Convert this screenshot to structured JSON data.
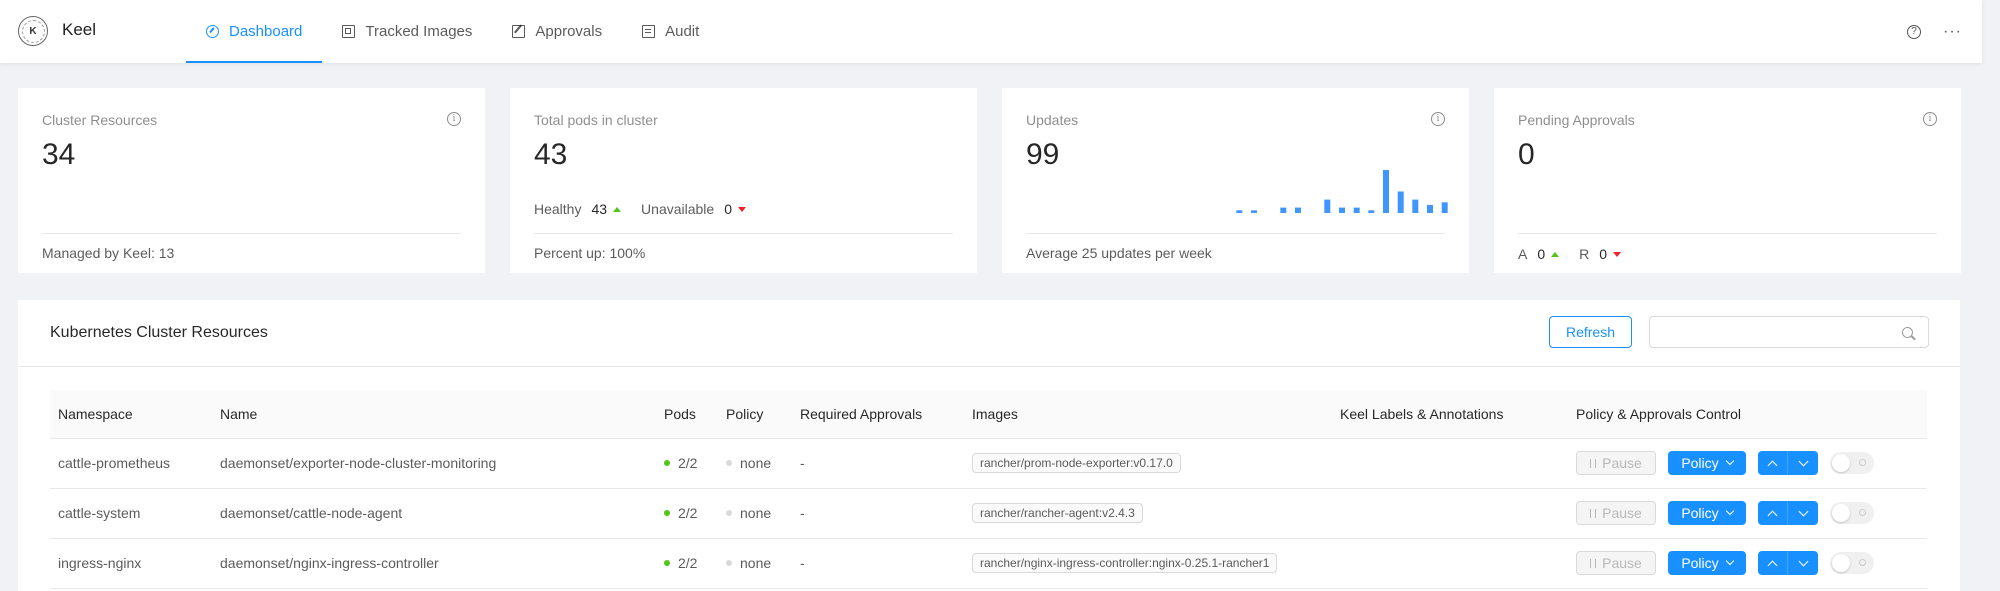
{
  "app": {
    "brand": "Keel",
    "logo_letter": "K",
    "accent": "#1890ff"
  },
  "nav": [
    {
      "label": "Dashboard",
      "icon": "dashboard-icon",
      "active": true
    },
    {
      "label": "Tracked Images",
      "icon": "images-icon",
      "active": false
    },
    {
      "label": "Approvals",
      "icon": "approvals-icon",
      "active": false
    },
    {
      "label": "Audit",
      "icon": "audit-icon",
      "active": false
    }
  ],
  "header_right": {
    "help": "?",
    "more": "···"
  },
  "cards": {
    "cluster": {
      "title": "Cluster Resources",
      "value": "34",
      "footer": "Managed by Keel: 13"
    },
    "pods": {
      "title": "Total pods in cluster",
      "value": "43",
      "healthy_label": "Healthy",
      "healthy_value": "43",
      "unavailable_label": "Unavailable",
      "unavailable_value": "0",
      "footer": "Percent up: 100%"
    },
    "updates": {
      "title": "Updates",
      "value": "99",
      "footer": "Average 25 updates per week"
    },
    "pending": {
      "title": "Pending Approvals",
      "value": "0",
      "a_label": "A",
      "a_value": "0",
      "r_label": "R",
      "r_value": "0"
    }
  },
  "updates_chart": {
    "type": "bar",
    "values": [
      1,
      1,
      0,
      2,
      2,
      0,
      5,
      2,
      2,
      1,
      16,
      8,
      5,
      3,
      4
    ]
  },
  "resources": {
    "title": "Kubernetes Cluster Resources",
    "refresh_label": "Refresh",
    "search_placeholder": "",
    "columns": [
      "Namespace",
      "Name",
      "Pods",
      "Policy",
      "Required Approvals",
      "Images",
      "Keel Labels & Annotations",
      "Policy & Approvals Control"
    ],
    "rows": [
      {
        "namespace": "cattle-prometheus",
        "name": "daemonset/exporter-node-cluster-monitoring",
        "pods": "2/2",
        "policy": "none",
        "approvals": "-",
        "image": "rancher/prom-node-exporter:v0.17.0"
      },
      {
        "namespace": "cattle-system",
        "name": "daemonset/cattle-node-agent",
        "pods": "2/2",
        "policy": "none",
        "approvals": "-",
        "image": "rancher/rancher-agent:v2.4.3"
      },
      {
        "namespace": "ingress-nginx",
        "name": "daemonset/nginx-ingress-controller",
        "pods": "2/2",
        "policy": "none",
        "approvals": "-",
        "image": "rancher/nginx-ingress-controller:nginx-0.25.1-rancher1"
      }
    ],
    "control": {
      "pause_label": "Pause",
      "policy_label": "Policy"
    }
  },
  "colors": {
    "success": "#52c41a",
    "error": "#f5222d",
    "bar": "#4096ff"
  }
}
